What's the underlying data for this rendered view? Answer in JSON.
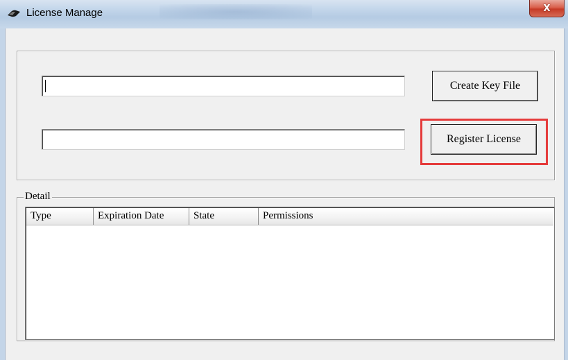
{
  "window": {
    "title": "License Manage",
    "close_label": "X",
    "icon": "app-icon"
  },
  "license": {
    "key_path_value": "",
    "license_path_value": "",
    "create_key_label": "Create Key File",
    "register_label": "Register License",
    "highlight_color": "#e53b3b"
  },
  "detail": {
    "label": "Detail",
    "columns": [
      "Type",
      "Expiration Date",
      "State",
      "Permissions"
    ],
    "rows": []
  }
}
